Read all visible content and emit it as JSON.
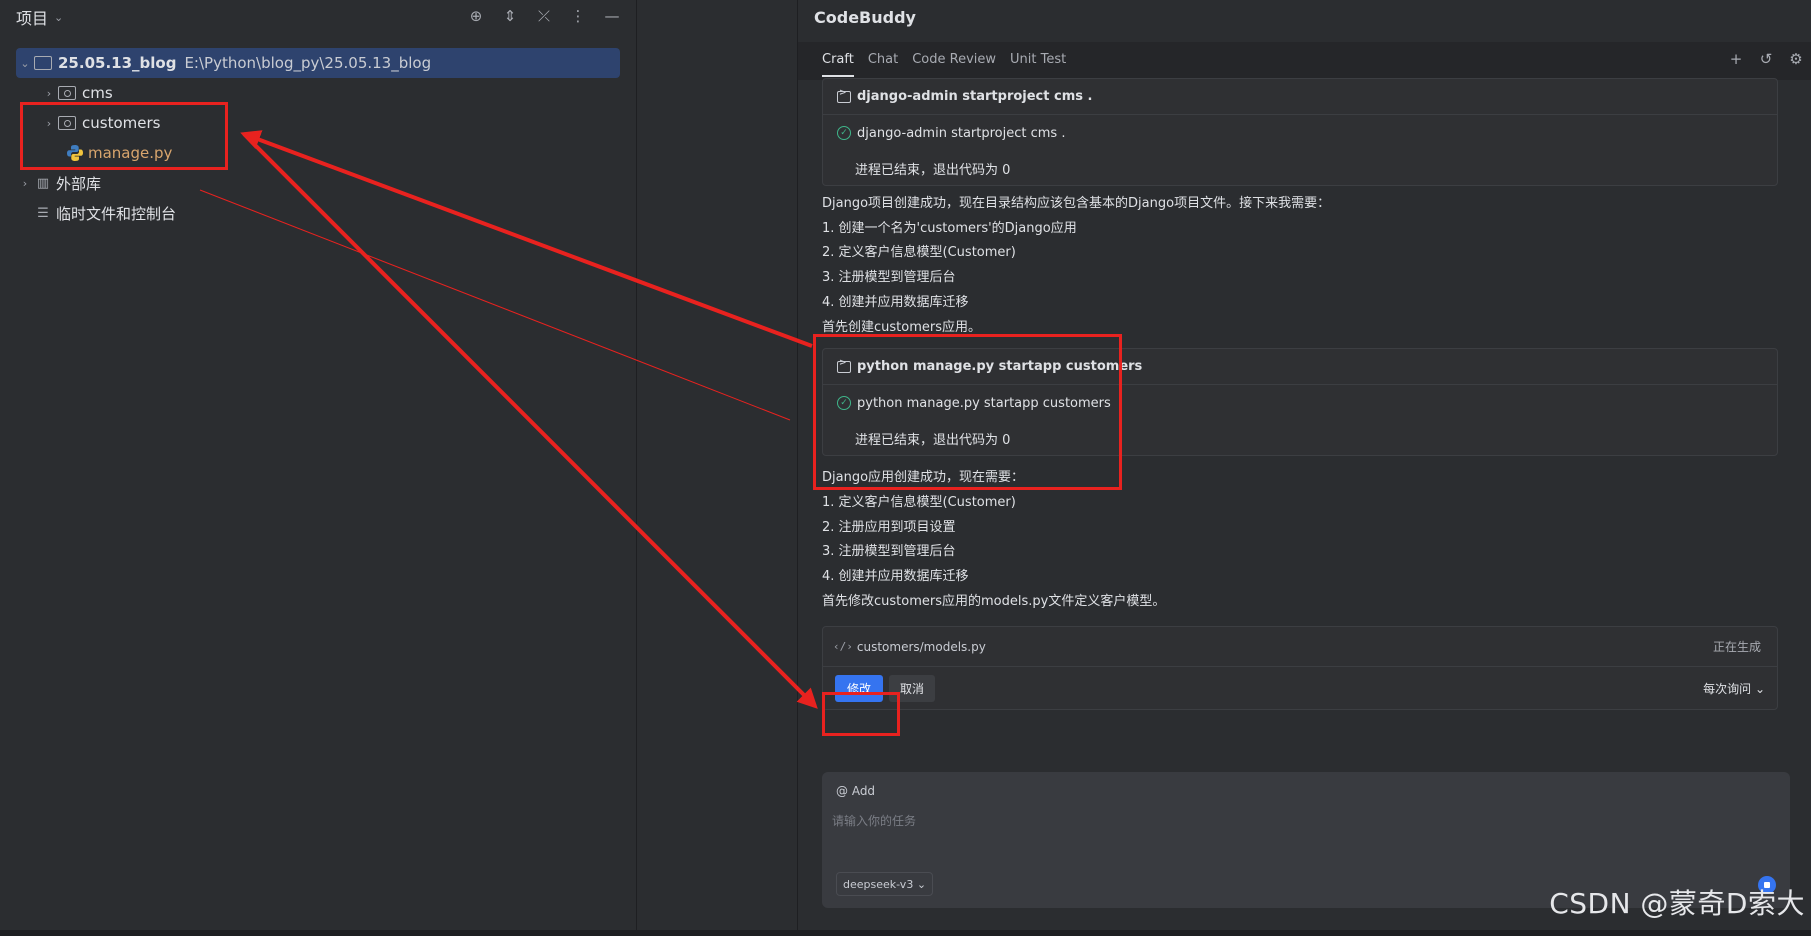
{
  "project_panel": {
    "title": "项目",
    "header_icons": [
      "locate-icon",
      "expand-all-icon",
      "collapse-all-icon",
      "more-icon",
      "minimize-icon"
    ],
    "root": {
      "name": "25.05.13_blog",
      "path": "E:\\Python\\blog_py\\25.05.13_blog"
    },
    "items": [
      {
        "label": "cms",
        "kind": "folder"
      },
      {
        "label": "customers",
        "kind": "folder"
      },
      {
        "label": "manage.py",
        "kind": "python-file"
      },
      {
        "label": "外部库",
        "kind": "library"
      },
      {
        "label": "临时文件和控制台",
        "kind": "scratch"
      }
    ]
  },
  "codebuddy": {
    "title": "CodeBuddy",
    "tabs": [
      "Craft",
      "Chat",
      "Code Review",
      "Unit Test"
    ],
    "active_tab": "Craft",
    "action_icons": [
      "plus-icon",
      "history-icon",
      "settings-icon"
    ],
    "cmd1": {
      "header": "django-admin startproject cms .",
      "command": "django-admin startproject cms .",
      "exit": "进程已结束，退出代码为 0"
    },
    "para1": [
      "Django项目创建成功，现在目录结构应该包含基本的Django项目文件。接下来我需要：",
      "1. 创建一个名为'customers'的Django应用",
      "2. 定义客户信息模型(Customer)",
      "3. 注册模型到管理后台",
      "4. 创建并应用数据库迁移",
      "首先创建customers应用。"
    ],
    "cmd2": {
      "header": "python manage.py startapp customers",
      "command": "python manage.py startapp customers",
      "exit": "进程已结束，退出代码为 0"
    },
    "para2": [
      "Django应用创建成功，现在需要：",
      "1. 定义客户信息模型(Customer)",
      "2. 注册应用到项目设置",
      "3. 注册模型到管理后台",
      "4. 创建并应用数据库迁移",
      "首先修改customers应用的models.py文件定义客户模型。"
    ],
    "edit": {
      "file": "customers/models.py",
      "status": "正在生成",
      "apply_label": "修改",
      "cancel_label": "取消",
      "mode": "每次询问"
    },
    "input": {
      "add_label": "@ Add",
      "placeholder": "请输入你的任务",
      "model": "deepseek-v3"
    }
  },
  "watermark": "CSDN @蒙奇D索大",
  "colors": {
    "annotation": "#e8221f",
    "accent": "#3574f0",
    "success": "#3fb58a",
    "selection": "#2e436e"
  }
}
